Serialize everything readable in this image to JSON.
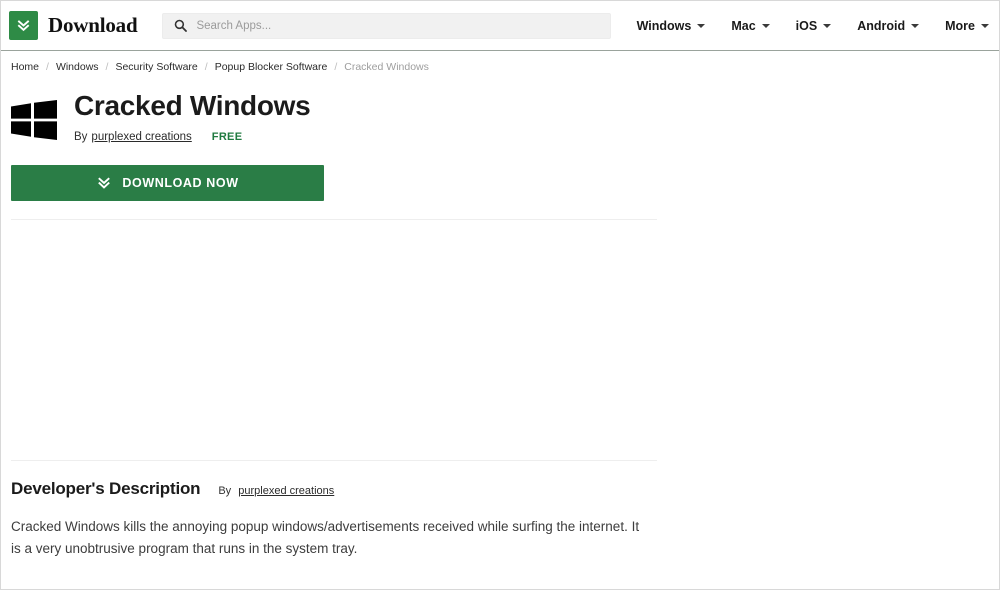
{
  "header": {
    "brand_name": "Download",
    "brand_icon": "double-chevron-down-icon",
    "search": {
      "placeholder": "Search Apps...",
      "value": "",
      "icon": "search-icon"
    },
    "nav": [
      {
        "label": "Windows",
        "caret": "chevron-down-icon"
      },
      {
        "label": "Mac",
        "caret": "chevron-down-icon"
      },
      {
        "label": "iOS",
        "caret": "chevron-down-icon"
      },
      {
        "label": "Android",
        "caret": "chevron-down-icon"
      },
      {
        "label": "More",
        "caret": "chevron-down-icon"
      }
    ]
  },
  "breadcrumb": {
    "separator": "/",
    "items": [
      {
        "label": "Home",
        "current": false
      },
      {
        "label": "Windows",
        "current": false
      },
      {
        "label": "Security Software",
        "current": false
      },
      {
        "label": "Popup Blocker Software",
        "current": false
      },
      {
        "label": "Cracked Windows",
        "current": true
      }
    ]
  },
  "app": {
    "icon": "windows-logo-icon",
    "title": "Cracked Windows",
    "by_label": "By",
    "author": "purplexed creations",
    "price": "FREE",
    "download_button": {
      "label": "DOWNLOAD NOW",
      "icon": "double-chevron-down-icon"
    }
  },
  "description": {
    "heading": "Developer's Description",
    "by_label": "By",
    "author": "purplexed creations",
    "body": "Cracked Windows kills the annoying popup windows/advertisements received while surfing the internet. It is a very unobtrusive program that runs in the system tray."
  },
  "colors": {
    "brand_green": "#2e8b46",
    "button_green": "#2a7d46",
    "price_green": "#1f7a3f",
    "text_dark": "#1b1b1b",
    "muted": "#9e9e9e",
    "search_bg": "#f1f1f1"
  }
}
